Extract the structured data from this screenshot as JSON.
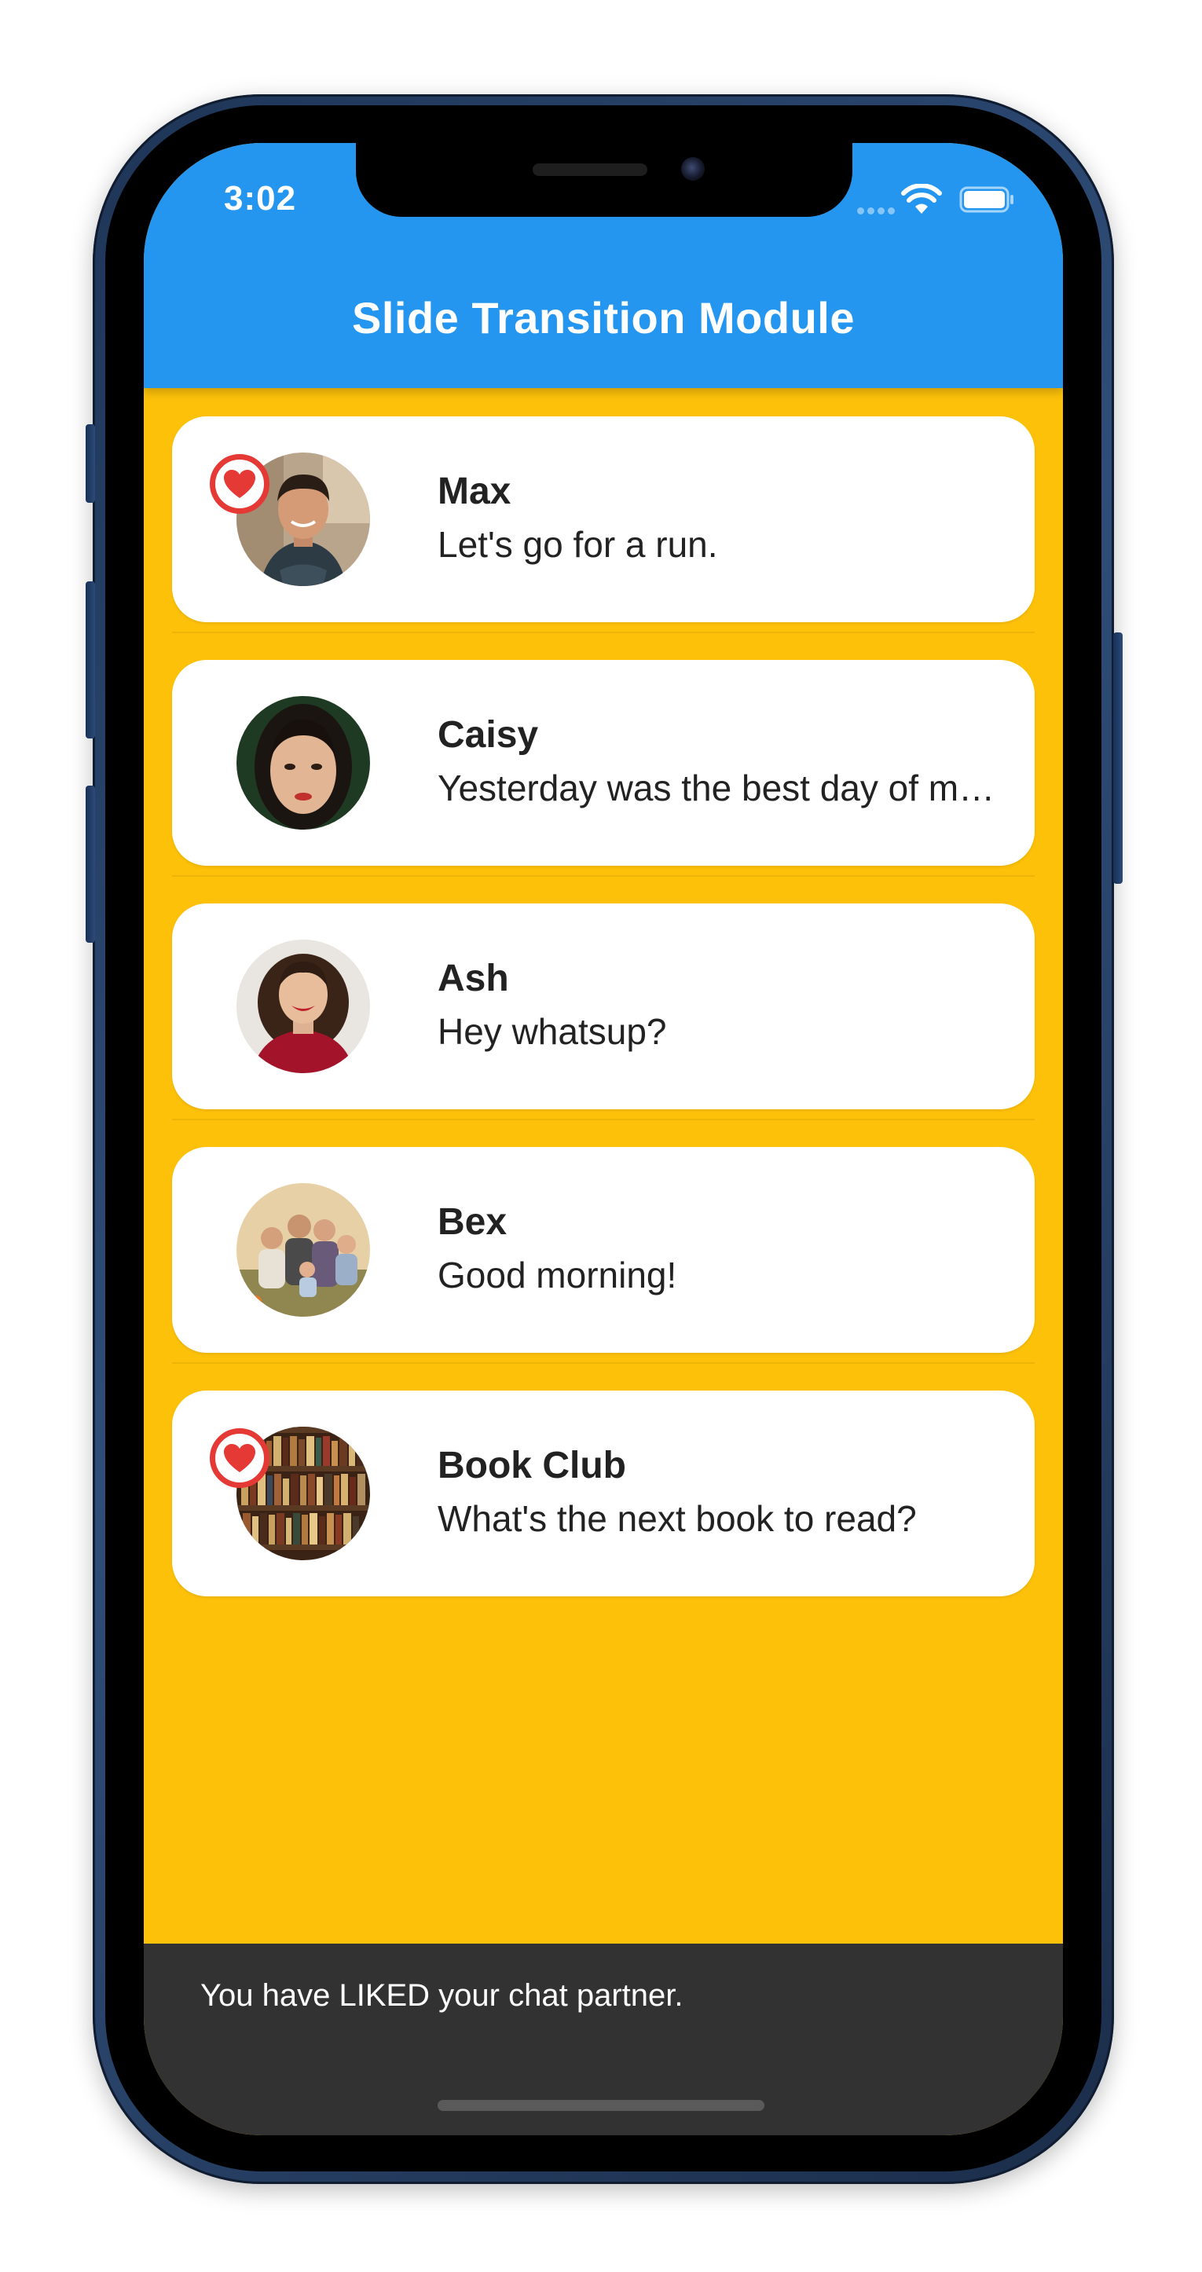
{
  "status_bar": {
    "time": "3:02",
    "wifi_icon": "wifi-icon",
    "battery_icon": "battery-icon"
  },
  "header": {
    "title": "Slide Transition Module"
  },
  "chats": [
    {
      "name": "Max",
      "message": "Let's go for a run.",
      "liked": true,
      "avatar": "man-portrait"
    },
    {
      "name": "Caisy",
      "message": "Yesterday was the best day of my life",
      "liked": false,
      "avatar": "woman-portrait"
    },
    {
      "name": "Ash",
      "message": "Hey whatsup?",
      "liked": false,
      "avatar": "woman-red-sweater-portrait"
    },
    {
      "name": "Bex",
      "message": "Good morning!",
      "liked": false,
      "avatar": "family-photo"
    },
    {
      "name": "Book Club",
      "message": "What's the next book to read?",
      "liked": true,
      "avatar": "bookshelf-photo"
    }
  ],
  "snackbar": {
    "message": "You have LIKED your chat partner."
  },
  "colors": {
    "app_bar": "#2496F0",
    "background": "#FDC10A",
    "card": "#FFFFFF",
    "heart": "#E53935",
    "snackbar": "#323232"
  }
}
